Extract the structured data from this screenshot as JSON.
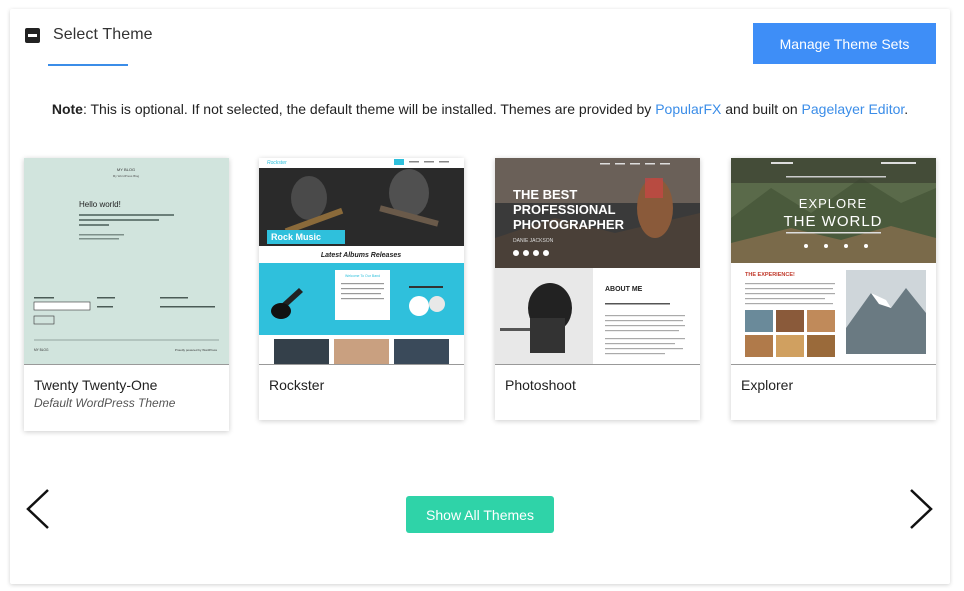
{
  "section": {
    "title": "Select Theme"
  },
  "header": {
    "manage_label": "Manage Theme Sets"
  },
  "note": {
    "label": "Note",
    "text1": ": This is optional. If not selected, the default theme will be installed. Themes are provided by ",
    "link1": "PopularFX",
    "text2": " and built on ",
    "link2": "Pagelayer Editor",
    "text3": "."
  },
  "themes": [
    {
      "name": "Twenty Twenty-One",
      "subtitle": "Default WordPress Theme",
      "preview": {
        "site_title": "MY BLOG",
        "tagline": "My WordPress Blog",
        "heading": "Hello world!",
        "footer_left": "MY BLOG",
        "footer_right": "Proudly powered by WordPress"
      }
    },
    {
      "name": "Rockster",
      "preview": {
        "logo": "Rockster",
        "banner": "Rock Music",
        "section_title": "Latest Albums Releases",
        "box_title": "Welcome To Our Band"
      }
    },
    {
      "name": "Photoshoot",
      "preview": {
        "line1": "THE BEST",
        "line2": "PROFESSIONAL",
        "line3": "PHOTOGRAPHER",
        "author": "DANIE JACKSON",
        "about": "ABOUT ME"
      }
    },
    {
      "name": "Explorer",
      "preview": {
        "line1": "EXPLORE",
        "line2": "THE WORLD",
        "section": "THE EXPERIENCE!"
      }
    }
  ],
  "footer": {
    "show_all_label": "Show All Themes"
  },
  "colors": {
    "accent_blue": "#3e8ef7",
    "accent_green": "#2fd3a8",
    "rockster_cyan": "#2fc0dc",
    "twentyone_green": "#d1e4dd"
  },
  "icons": {
    "toggle": "minus-square-icon",
    "prev": "chevron-left-icon",
    "next": "chevron-right-icon"
  }
}
